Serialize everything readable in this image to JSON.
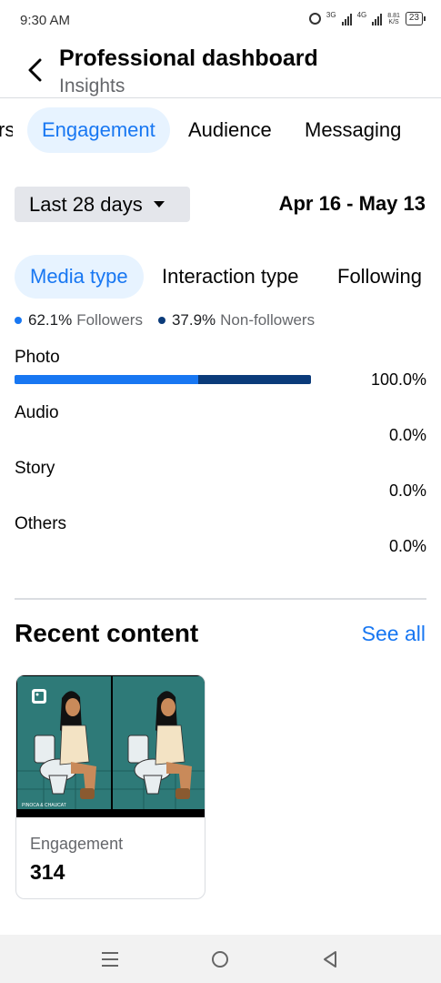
{
  "status_bar": {
    "time": "9:30 AM",
    "net1": "3G",
    "net2": "4G",
    "speed": "8.81",
    "speed_unit": "K/S",
    "battery": "23"
  },
  "header": {
    "title": "Professional dashboard",
    "subtitle": "Insights"
  },
  "tabs": {
    "partial": "rs",
    "active": "Engagement",
    "audience": "Audience",
    "messaging": "Messaging"
  },
  "date": {
    "selected": "Last 28 days",
    "range": "Apr 16 - May 13"
  },
  "subtabs": {
    "active": "Media type",
    "interaction": "Interaction type",
    "following": "Following"
  },
  "legend": [
    {
      "value": "62.1%",
      "label": "Followers",
      "color": "#1877f2"
    },
    {
      "value": "37.9%",
      "label": "Non-followers",
      "color": "#0b3b7a"
    }
  ],
  "rows": [
    {
      "label": "Photo",
      "value": "100.0%",
      "followers_fraction": 0.621,
      "non_followers_fraction": 0.379
    },
    {
      "label": "Audio",
      "value": "0.0%"
    },
    {
      "label": "Story",
      "value": "0.0%"
    },
    {
      "label": "Others",
      "value": "0.0%"
    }
  ],
  "recent": {
    "title": "Recent content",
    "see_all": "See all",
    "card": {
      "label": "Engagement",
      "value": "314",
      "thumb_text": "PINOCA & CHAUCAT"
    }
  },
  "colors": {
    "accent": "#1877f2",
    "dark_series": "#0b3b7a",
    "tile_bg": "#2e7a78"
  },
  "nav": {
    "icons": [
      "menu-icon",
      "home-circle-icon",
      "back-triangle-icon"
    ]
  }
}
